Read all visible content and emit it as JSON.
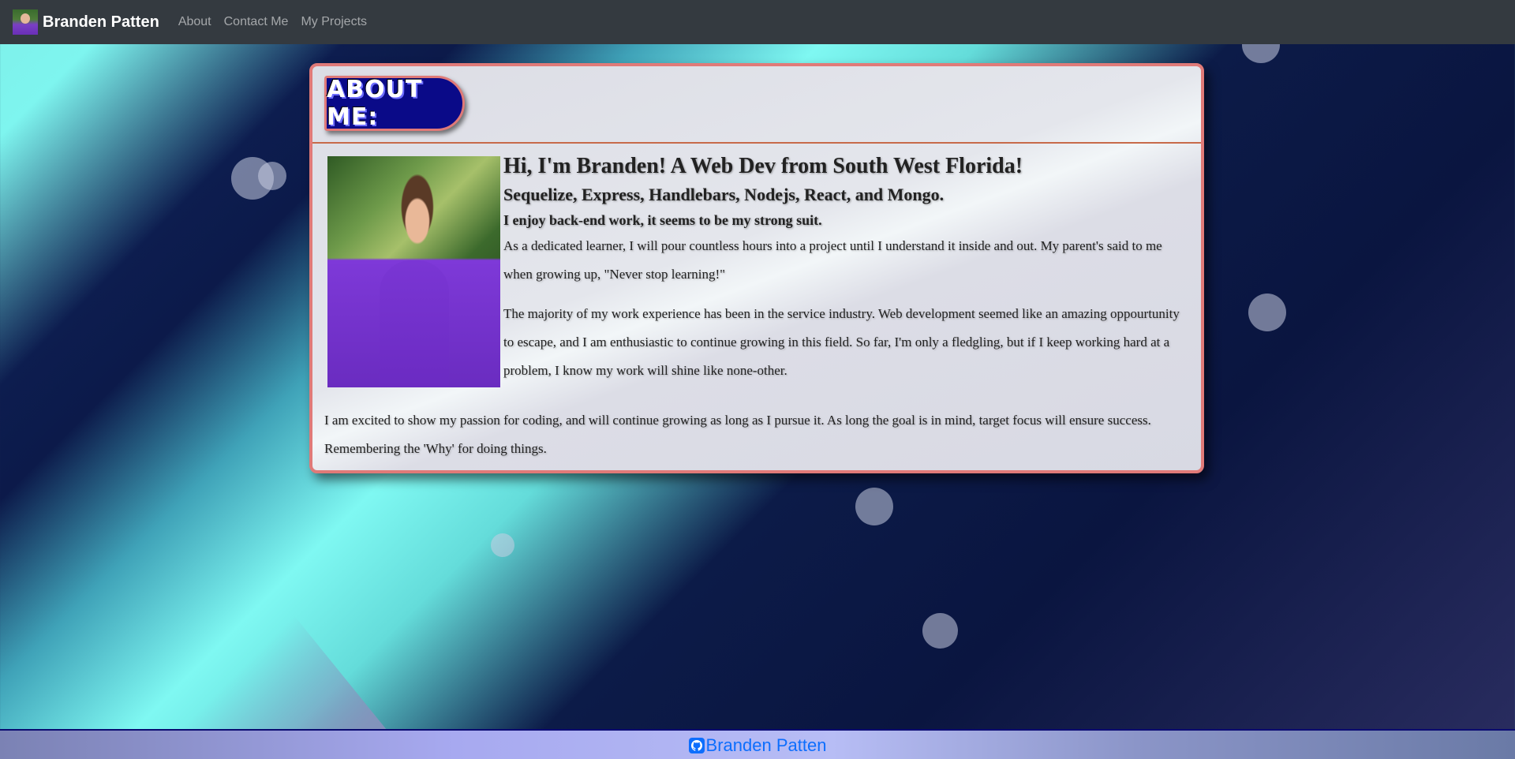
{
  "navbar": {
    "brand_name": "Branden Patten",
    "links": [
      "About",
      "Contact Me",
      "My Projects"
    ]
  },
  "card": {
    "badge": "ABOUT ME:",
    "heading": "Hi, I'm Branden! A Web Dev from South West Florida!",
    "stack": "Sequelize, Express, Handlebars, Nodejs, React, and Mongo.",
    "strength": "I enjoy back-end work, it seems to be my strong suit.",
    "paragraph_1": "As a dedicated learner, I will pour countless hours into a project until I understand it inside and out. My parent's said to me when growing up, \"Never stop learning!\"",
    "paragraph_2": "The majority of my work experience has been in the service industry. Web development seemed like an amazing oppourtunity to escape, and I am enthusiastic to continue growing in this field. So far, I'm only a fledgling, but if I keep working hard at a problem, I know my work will shine like none-other.",
    "paragraph_3": "I am excited to show my passion for coding, and will continue growing as long as I pursue it. As long the goal is in mind, target focus will ensure success. Remembering the 'Why' for doing things."
  },
  "footer": {
    "link_text": "Branden Patten",
    "icon": "github-icon"
  },
  "colors": {
    "navbar_bg": "#343a40",
    "card_border": "#e07a78",
    "badge_bg": "#0a0a88",
    "footer_link": "#0d6efd"
  }
}
